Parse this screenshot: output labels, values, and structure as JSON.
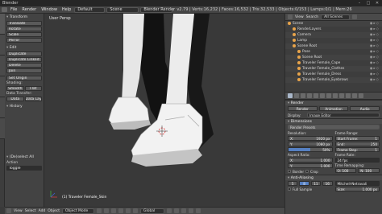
{
  "window": {
    "title": "Blender",
    "buttons": [
      "–",
      "□",
      "✕"
    ]
  },
  "infobar": {
    "menus": [
      "File",
      "Render",
      "Window",
      "Help"
    ],
    "layout": "Default",
    "scene": "Scene",
    "engine": "Blender Render",
    "stats": "v2.79 | Verts:16,232 | Faces:16,532 | Tris:32,533 | Objects:0/153 | Lamps:0/1 | Mem:26"
  },
  "toolshelf": {
    "transform_header": "Transform",
    "transform_buttons": [
      "Translate",
      "Rotate",
      "Scale",
      "Mirror"
    ],
    "edit_header": "Edit",
    "edit_buttons": [
      "Duplicate",
      "Duplicate Linked",
      "Delete",
      "Join"
    ],
    "set_origin": "Set Origin",
    "shading_label": "Shading:",
    "shading_buttons": [
      "Smooth",
      "Flat"
    ],
    "data_transfer_label": "Data Transfer:",
    "data_buttons": [
      "Data",
      "Data Lay"
    ],
    "history_header": "History",
    "deselect_header": "(De)select All",
    "action_label": "Action",
    "action_value": "Toggle"
  },
  "viewport": {
    "label": "User Persp",
    "object_label": "(1) Traveler Female_Skin"
  },
  "view_header": {
    "items": [
      "View",
      "Select",
      "Add",
      "Object"
    ],
    "mode": "Object Mode",
    "pivot": "Global"
  },
  "outliner": {
    "menus": [
      "View",
      "Search",
      "All Scenes"
    ],
    "rows": [
      {
        "label": "Scene",
        "indent": 0
      },
      {
        "label": "RenderLayers",
        "indent": 1
      },
      {
        "label": "Camera",
        "indent": 1
      },
      {
        "label": "Lamp",
        "indent": 1
      },
      {
        "label": "Scene Root",
        "indent": 1
      },
      {
        "label": "Pose",
        "indent": 2
      },
      {
        "label": "Scene Root",
        "indent": 2
      },
      {
        "label": "Traveler Female_Cape",
        "indent": 2
      },
      {
        "label": "Traveler Female_Clothes",
        "indent": 2
      },
      {
        "label": "Traveler Female_Dress",
        "indent": 2
      },
      {
        "label": "Traveler Female_Eyebrows",
        "indent": 2
      }
    ]
  },
  "properties": {
    "render_header": "Render",
    "render_buttons": [
      "Render",
      "Animation",
      "Audio"
    ],
    "display_label": "Display:",
    "display_value": "Image Editor",
    "dimensions_header": "Dimensions",
    "presets": "Render Presets",
    "resolution_label": "Resolution:",
    "res_x": {
      "label": "X:",
      "value": "1920 px"
    },
    "res_y": {
      "label": "Y:",
      "value": "1080 px"
    },
    "res_pct": {
      "value": "50%",
      "percent": 50
    },
    "aspect_label": "Aspect Ratio:",
    "aspect_x": {
      "label": "X:",
      "value": "1.000"
    },
    "aspect_y": {
      "label": "Y:",
      "value": "1.000"
    },
    "frame_range_label": "Frame Range:",
    "start": {
      "label": "Start Frame:",
      "value": "1"
    },
    "end": {
      "label": "End:",
      "value": "250"
    },
    "step": {
      "label": "Frame Step:",
      "value": "1"
    },
    "frame_rate_label": "Frame Rate:",
    "fps": "24 fps",
    "time_remap_label": "Time Remapping:",
    "old": "O: 100",
    "new": "N: 100",
    "border_label": "Border",
    "crop_label": "Crop",
    "aa_header": "Anti-Aliasing",
    "aa_buttons": [
      "5",
      "8",
      "11",
      "16"
    ],
    "aa_filter": "Mitchell-Netravali",
    "full_sample": "Full Sample",
    "size_label": "Size:",
    "size_value": "1.000 px"
  }
}
